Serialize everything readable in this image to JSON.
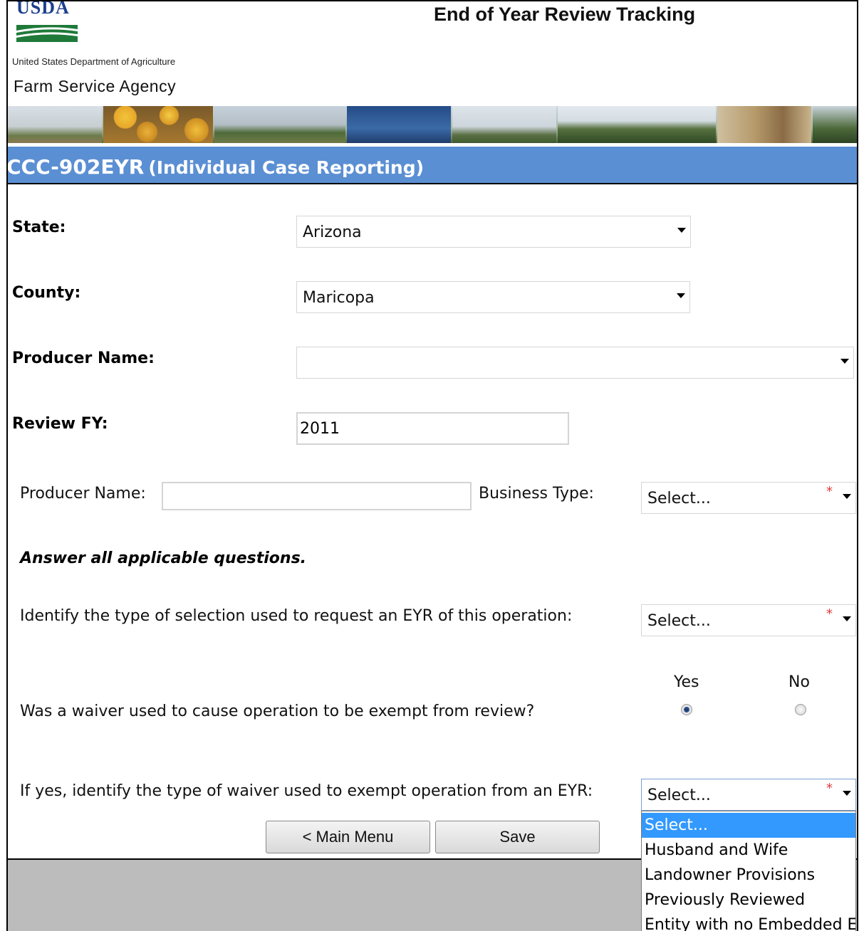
{
  "header": {
    "logo_text": "USDA",
    "department": "United States Department of Agriculture",
    "agency": "Farm Service Agency",
    "app_title": "End of Year Review Tracking"
  },
  "page": {
    "title_main": "CCC-902EYR",
    "title_sub": "(Individual Case Reporting)"
  },
  "form": {
    "state": {
      "label": "State:",
      "value": "Arizona"
    },
    "county": {
      "label": "County:",
      "value": "Maricopa"
    },
    "producer_select": {
      "label": "Producer Name:",
      "value": ""
    },
    "review_fy": {
      "label": "Review FY:",
      "value": "2011"
    },
    "producer_name": {
      "label": "Producer Name:",
      "value": ""
    },
    "business_type": {
      "label": "Business Type:",
      "value": "Select..."
    },
    "instruction": "Answer all applicable questions.",
    "selection_type": {
      "label": "Identify the type of selection used to request an EYR of this operation:",
      "value": "Select..."
    },
    "waiver_used": {
      "label": "Was a waiver used to cause operation to be exempt from review?",
      "yes_label": "Yes",
      "no_label": "No",
      "selected": "Yes"
    },
    "waiver_type": {
      "label": "If yes, identify the type of waiver used to exempt operation from an EYR:",
      "value": "Select...",
      "options": [
        "Select...",
        "Husband and Wife",
        "Landowner Provisions",
        "Previously Reviewed",
        "Entity with no Embedded E"
      ]
    },
    "required_marker": "*"
  },
  "buttons": {
    "main_menu": "< Main Menu",
    "save": "Save"
  }
}
